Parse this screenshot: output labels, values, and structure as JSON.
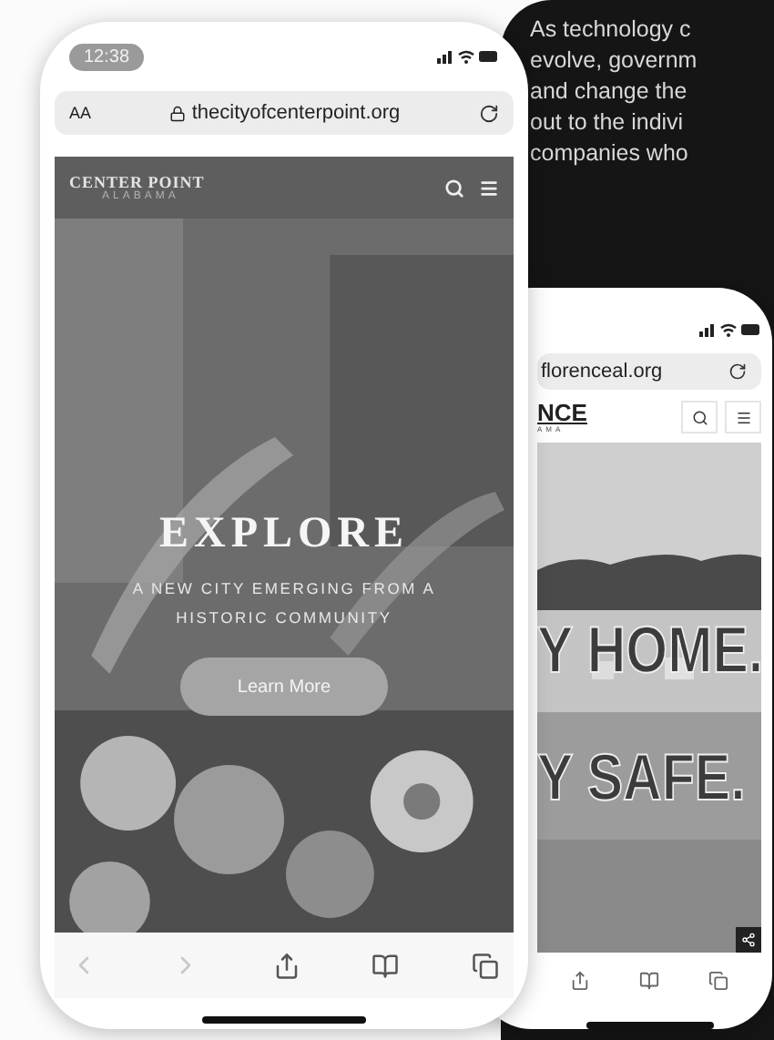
{
  "background_text": {
    "lines": [
      "As technology c",
      "evolve, governm",
      "and change the",
      "out to the indivi",
      "companies who"
    ]
  },
  "front_phone": {
    "time": "12:38",
    "url_bar": {
      "text_size": "AA",
      "url": "thecityofcenterpoint.org"
    },
    "site_header": {
      "name": "CENTER POINT",
      "subtitle": "ALABAMA"
    },
    "hero": {
      "title": "EXPLORE",
      "subtitle": "A NEW CITY EMERGING FROM A HISTORIC COMMUNITY",
      "button": "Learn More"
    },
    "toolbar": {
      "back_disabled": true,
      "forward_disabled": true
    }
  },
  "back_phone": {
    "url_bar": {
      "url": "florenceal.org"
    },
    "site_header": {
      "name": "NCE",
      "subtitle": "AMA"
    },
    "hero": {
      "lines": [
        "Y HOME.",
        "Y SAFE."
      ]
    }
  }
}
